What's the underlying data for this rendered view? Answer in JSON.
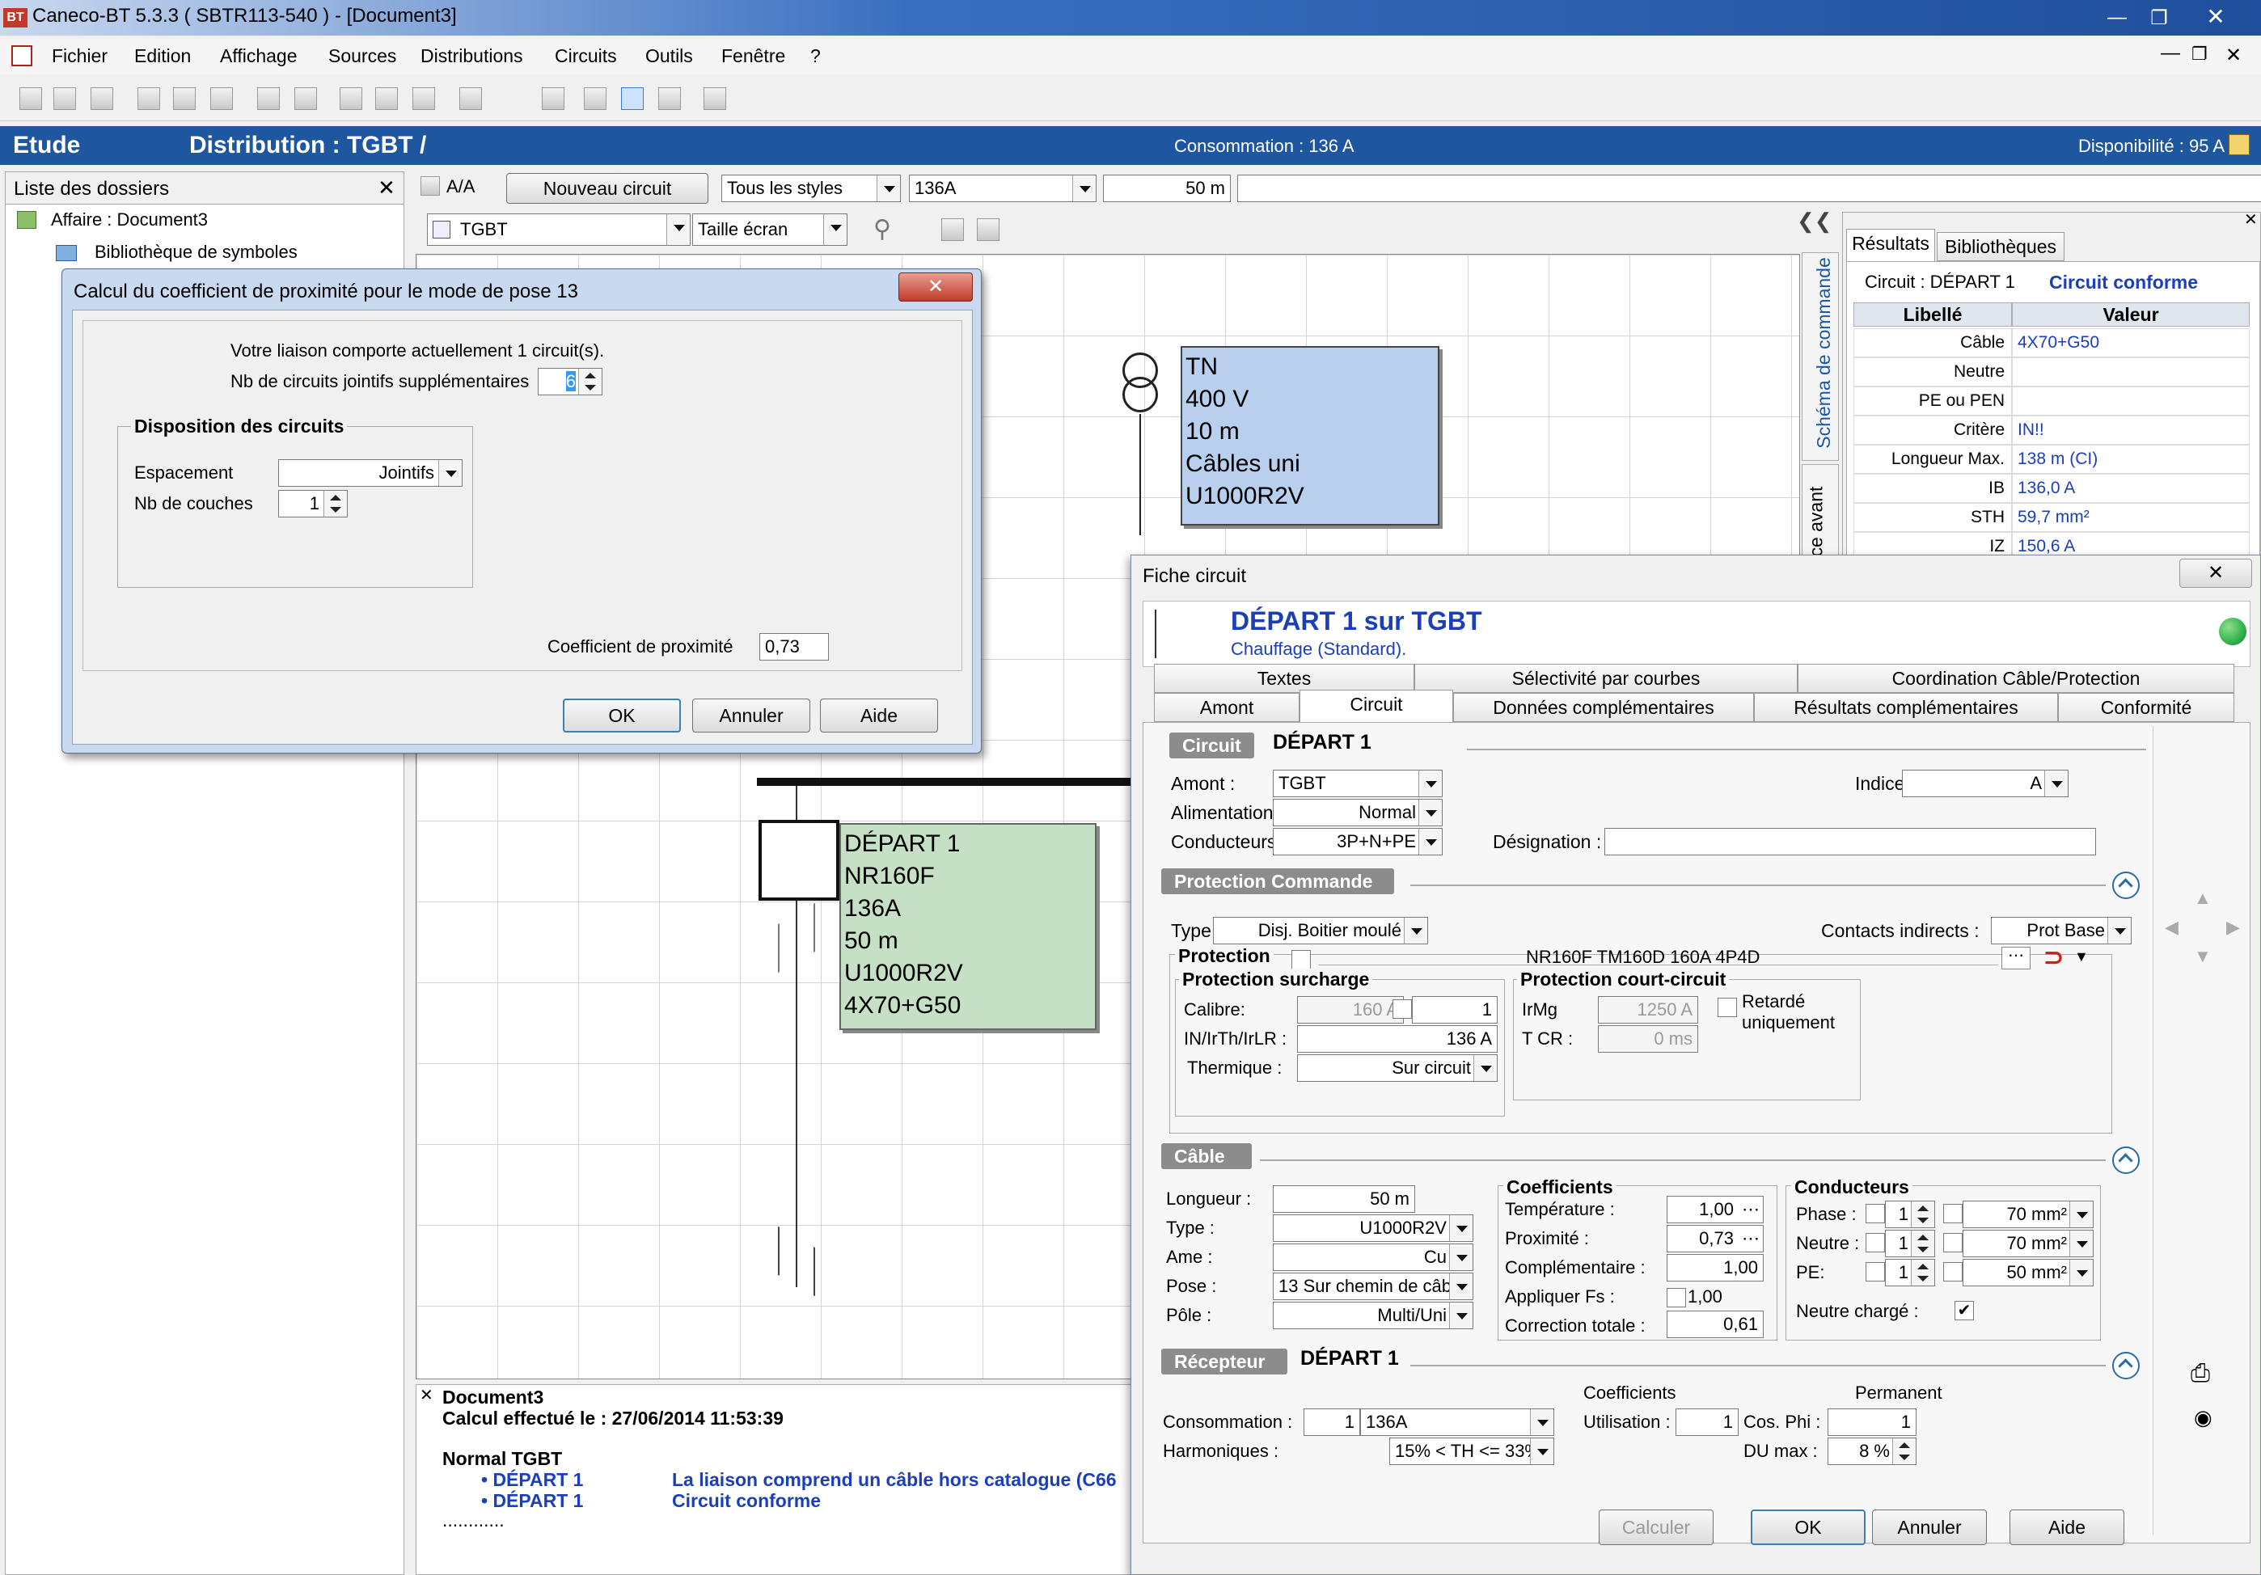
{
  "window": {
    "title": "Caneco-BT 5.3.3 ( SBTR113-540 ) - [Document3]"
  },
  "menu": [
    "Fichier",
    "Edition",
    "Affichage",
    "Sources",
    "Distributions",
    "Circuits",
    "Outils",
    "Fenêtre",
    "?"
  ],
  "header": {
    "etude": "Etude",
    "distribution": "Distribution : TGBT /",
    "consommation": "Consommation : 136 A",
    "disponibilite": "Disponibilité : 95 A"
  },
  "sidebar": {
    "title": "Liste des dossiers",
    "items": [
      "Affaire : Document3",
      "Bibliothèque de symboles"
    ]
  },
  "toolbar2": {
    "aa": "A/A",
    "nouveau": "Nouveau circuit",
    "styles": "Tous les styles",
    "current": "136A",
    "length": "50 m",
    "tableau": "TGBT",
    "zoom": "Taille écran"
  },
  "diagram": {
    "source": [
      "TN",
      "400 V",
      "10 m",
      "Câbles uni",
      "U1000R2V"
    ],
    "depart": [
      "DÉPART 1",
      "NR160F",
      "136A",
      "50 m",
      "U1000R2V",
      "4X70+G50"
    ],
    "vertical_tabs": [
      "Schéma de commande",
      "Face avant"
    ]
  },
  "results": {
    "tabs": [
      "Résultats",
      "Bibliothèques"
    ],
    "circuit": "Circuit : DÉPART 1",
    "status": "Circuit conforme",
    "col_libelle": "Libellé",
    "col_valeur": "Valeur",
    "rows": [
      [
        "Câble",
        "4X70+G50"
      ],
      [
        "Neutre",
        ""
      ],
      [
        "PE ou PEN",
        ""
      ],
      [
        "Critère",
        "IN!!"
      ],
      [
        "Longueur Max.",
        "138 m (CI)"
      ],
      [
        "IB",
        "136,0 A"
      ],
      [
        "STH",
        "59,7 mm²"
      ],
      [
        "IZ",
        "150,6 A"
      ]
    ]
  },
  "log": {
    "title": "Document3",
    "calc": "Calcul effectué le : 27/06/2014 11:53:39",
    "group": "Normal TGBT",
    "lines": [
      [
        "• DÉPART 1",
        "La liaison comprend un câble hors catalogue (C66"
      ],
      [
        "• DÉPART 1",
        "Circuit conforme"
      ]
    ],
    "dots": "............"
  },
  "prox": {
    "title": "Calcul du coefficient de proximité pour le mode de pose 13",
    "info": "Votre liaison comporte actuellement 1 circuit(s).",
    "nb_label": "Nb de circuits jointifs supplémentaires",
    "nb_value": "6",
    "group": "Disposition des circuits",
    "esp_label": "Espacement",
    "esp_value": "Jointifs",
    "couches_label": "Nb de couches",
    "couches_value": "1",
    "coef_label": "Coefficient de proximité",
    "coef_value": "0,73",
    "ok": "OK",
    "annuler": "Annuler",
    "aide": "Aide"
  },
  "fiche": {
    "title": "Fiche circuit",
    "heading": "DÉPART 1 sur TGBT",
    "subheading": "Chauffage (Standard).",
    "tabs_top": [
      "Textes",
      "Sélectivité par courbes",
      "Coordination Câble/Protection"
    ],
    "tabs_bottom": [
      "Amont",
      "Circuit",
      "Données complémentaires",
      "Résultats complémentaires",
      "Conformité"
    ],
    "circuit_sec": "Circuit",
    "circuit_name": "DÉPART 1",
    "amont_l": "Amont :",
    "amont_v": "TGBT",
    "alim_l": "Alimentation :",
    "alim_v": "Normal",
    "cond_l": "Conducteurs :",
    "cond_v": "3P+N+PE",
    "indice_l": "Indice :",
    "indice_v": "A",
    "design_l": "Désignation :",
    "design_v": "",
    "protcmd_sec": "Protection Commande",
    "type_l": "Type :",
    "type_v": "Disj. Boitier moulé",
    "contacts_l": "Contacts indirects :",
    "contacts_v": "Prot Base",
    "protection_l": "Protection",
    "protection_v": "NR160F TM160D  160A 4P4D",
    "surcharge": "Protection surcharge",
    "calibre_l": "Calibre:",
    "calibre_v": "160 A",
    "calibre_n": "1",
    "in_l": "IN/IrTh/IrLR :",
    "in_v": "136 A",
    "therm_l": "Thermique :",
    "therm_v": "Sur circuit",
    "cc": "Protection court-circuit",
    "irmg_l": "IrMg",
    "irmg_v": "1250 A",
    "tcr_l": "T CR :",
    "tcr_v": "0 ms",
    "retarde": "Retardé uniquement",
    "cable_sec": "Câble",
    "long_l": "Longueur :",
    "long_v": "50 m",
    "ctype_l": "Type :",
    "ctype_v": "U1000R2V",
    "ame_l": "Ame :",
    "ame_v": "Cu",
    "pose_l": "Pose :",
    "pose_v": "13  Sur chemin de câb",
    "pole_l": "Pôle :",
    "pole_v": "Multi/Uni",
    "coef_title": "Coefficients",
    "temp_l": "Température :",
    "temp_v": "1,00",
    "prox_l": "Proximité :",
    "prox_v": "0,73",
    "compl_l": "Complémentaire :",
    "compl_v": "1,00",
    "fs_l": "Appliquer Fs :",
    "fs_v": "1,00",
    "corr_l": "Correction totale :",
    "corr_v": "0,61",
    "cond_title": "Conducteurs",
    "phase_l": "Phase :",
    "phase_n": "1",
    "phase_v": "70 mm²",
    "neutre_l": "Neutre :",
    "neutre_n": "1",
    "neutre_v": "70 mm²",
    "pe_l": "PE:",
    "pe_n": "1",
    "pe_v": "50 mm²",
    "nc_l": "Neutre chargé :",
    "recep_sec": "Récepteur",
    "recep_name": "DÉPART 1",
    "coeffs_l": "Coefficients",
    "perm_l": "Permanent",
    "conso_l": "Consommation :",
    "conso_n": "1",
    "conso_v": "136A",
    "util_l": "Utilisation :",
    "util_v": "1",
    "cos_l": "Cos. Phi :",
    "cos_v": "1",
    "harm_l": "Harmoniques :",
    "harm_v": "15% < TH <= 33%",
    "du_l": "DU max :",
    "du_v": "8 %",
    "btn_calc": "Calculer",
    "btn_ok": "OK",
    "btn_annuler": "Annuler",
    "btn_aide": "Aide"
  },
  "colors": {
    "titlebar": "#2c5aa0",
    "blue_header": "#1e56a0",
    "source_box": "#b8d0ee",
    "depart_box": "#c5e0c5",
    "link_blue": "#1a3fb8",
    "status_green": "#2fb34a"
  }
}
